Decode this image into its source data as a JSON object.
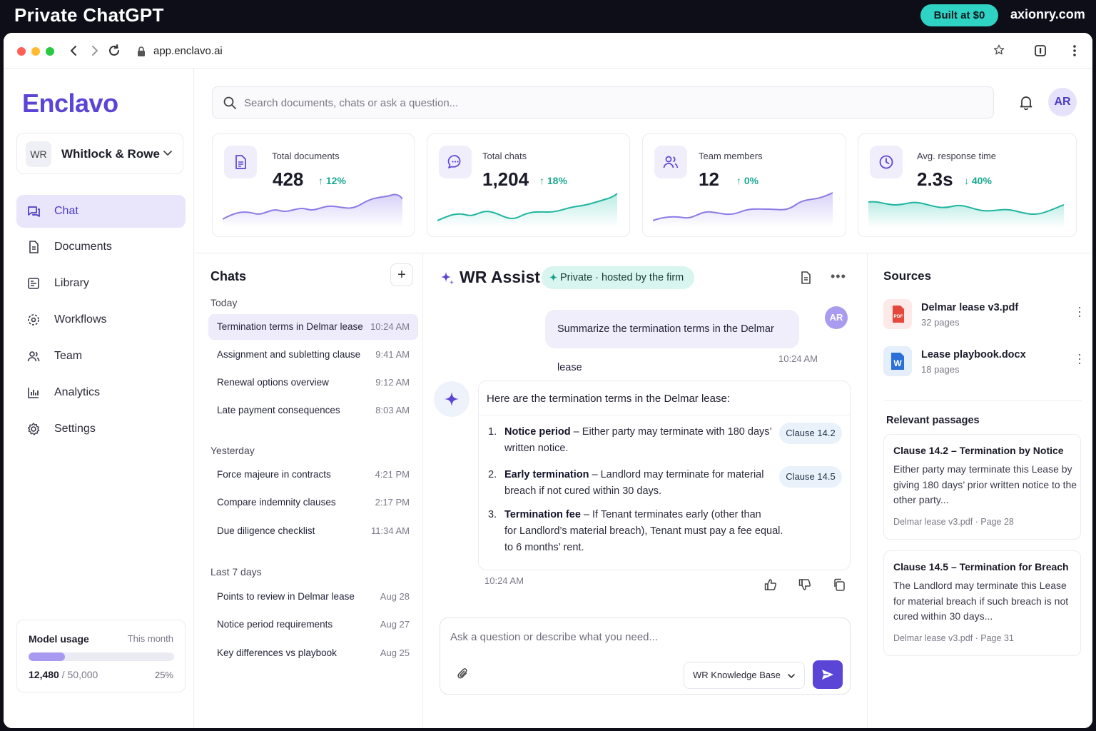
{
  "promo": {
    "title": "Private ChatGPT",
    "badge": "Built at $0",
    "site": "axionry.com"
  },
  "browser": {
    "url": "app.enclavo.ai"
  },
  "app": {
    "logo": "Enclavo"
  },
  "org": {
    "initials": "WR",
    "name": "Whitlock & Rowe"
  },
  "sidebar": {
    "items": [
      {
        "label": "Chat",
        "icon": "chat-icon",
        "active": true
      },
      {
        "label": "Documents",
        "icon": "document-icon"
      },
      {
        "label": "Library",
        "icon": "library-icon"
      },
      {
        "label": "Workflows",
        "icon": "workflow-icon"
      },
      {
        "label": "Team",
        "icon": "team-icon"
      },
      {
        "label": "Analytics",
        "icon": "analytics-icon"
      },
      {
        "label": "Settings",
        "icon": "gear-icon"
      }
    ]
  },
  "usage": {
    "title": "Model usage",
    "period": "This month",
    "used": "12,480",
    "limit": "/ 50,000",
    "percent": "25%",
    "fraction": 0.25
  },
  "header": {
    "search_placeholder": "Search documents, chats or ask a question...",
    "avatar": "AR"
  },
  "stats": [
    {
      "label": "Total documents",
      "value": "428",
      "delta": "12%",
      "direction": "up",
      "icon": "document-icon",
      "color": "#8b7be6"
    },
    {
      "label": "Total chats",
      "value": "1,204",
      "delta": "18%",
      "direction": "up",
      "icon": "chat-bubble-icon",
      "color": "#1fb5a0"
    },
    {
      "label": "Team members",
      "value": "12",
      "delta": "0%",
      "direction": "up",
      "icon": "team-icon",
      "color": "#8b7be6"
    },
    {
      "label": "Avg. response time",
      "value": "2.3s",
      "delta": "40%",
      "direction": "down",
      "icon": "clock-icon",
      "color": "#1fb5a0"
    }
  ],
  "chats": {
    "title": "Chats",
    "groups": [
      {
        "label": "Today",
        "items": [
          {
            "name": "Termination terms in Delmar lease",
            "time": "10:24 AM",
            "active": true
          },
          {
            "name": "Assignment and subletting clause",
            "time": "9:41 AM"
          },
          {
            "name": "Renewal options overview",
            "time": "9:12 AM"
          },
          {
            "name": "Late payment consequences",
            "time": "8:03 AM"
          }
        ]
      },
      {
        "label": "Yesterday",
        "items": [
          {
            "name": "Force majeure in contracts",
            "time": "4:21 PM"
          },
          {
            "name": "Compare indemnity clauses",
            "time": "2:17 PM"
          },
          {
            "name": "Due diligence checklist",
            "time": "11:34 AM"
          }
        ]
      },
      {
        "label": "Last 7 days",
        "items": [
          {
            "name": "Points to review in Delmar lease",
            "time": "Aug 28"
          },
          {
            "name": "Notice period requirements",
            "time": "Aug 27"
          },
          {
            "name": "Key differences vs playbook",
            "time": "Aug 25"
          }
        ]
      }
    ]
  },
  "thread": {
    "title": "WR Assist",
    "badge": "Private · hosted by the firm",
    "user_avatar": "AR",
    "user_message": "Summarize the termination terms in the Delmar lease",
    "user_time": "10:24 AM",
    "assistant_intro": "Here are the termination terms in the Delmar lease:",
    "points": [
      {
        "num": "1.",
        "title": "Notice period",
        "line1": " – Either party may terminate with 180 days’",
        "line2": "written notice.",
        "clause": "Clause 14.2"
      },
      {
        "num": "2.",
        "title": "Early termination",
        "line1": " – Landlord may terminate for material",
        "line2": "breach if not cured within 30 days.",
        "clause": "Clause 14.5"
      },
      {
        "num": "3.",
        "title": "Termination fee",
        "line1": " – If Tenant terminates early (other than",
        "line2": "for Landlord’s material breach), Tenant must pay a fee equal.",
        "line3": "to 6 months’ rent."
      }
    ],
    "assistant_time": "10:24 AM",
    "compose_placeholder": "Ask a question or describe what you need...",
    "knowledge_base": "WR Knowledge Base"
  },
  "sources": {
    "title": "Sources",
    "files": [
      {
        "name": "Delmar lease v3.pdf",
        "pages": "32 pages",
        "type": "PDF",
        "color": "#e5483b"
      },
      {
        "name": "Lease playbook.docx",
        "pages": "18 pages",
        "type": "W",
        "color": "#2b6fd8"
      }
    ],
    "passages_title": "Relevant passages",
    "passages": [
      {
        "title": "Clause 14.2 – Termination by Notice",
        "body": "Either party may terminate this Lease by giving 180 days’ prior written notice to the other party...",
        "ref": "Delmar lease v3.pdf · Page 28"
      },
      {
        "title": "Clause 14.5 – Termination for Breach",
        "body": "The Landlord may terminate this Lease for material breach if such breach is not cured within 30 days...",
        "ref": "Delmar lease v3.pdf · Page 31"
      }
    ]
  }
}
